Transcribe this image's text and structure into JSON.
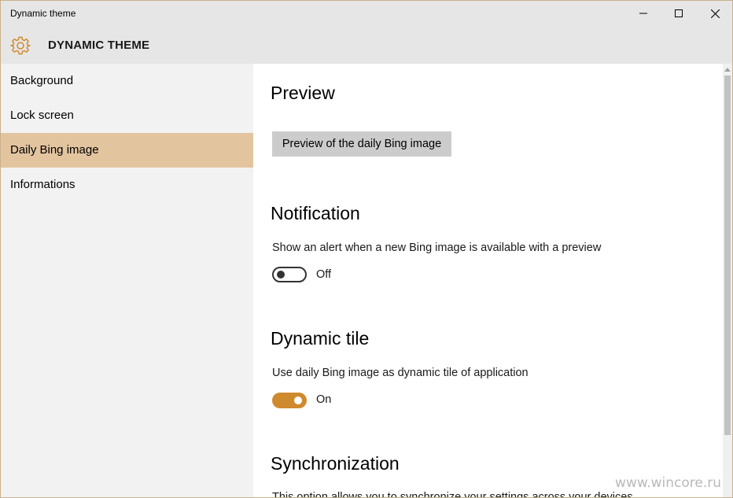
{
  "window": {
    "title": "Dynamic theme"
  },
  "caption_buttons": {
    "minimize": "minimize-icon",
    "maximize": "maximize-icon",
    "close": "close-icon"
  },
  "header": {
    "icon": "gear-icon",
    "title": "DYNAMIC THEME"
  },
  "sidebar": {
    "items": [
      {
        "label": "Background",
        "selected": false
      },
      {
        "label": "Lock screen",
        "selected": false
      },
      {
        "label": "Daily Bing image",
        "selected": true
      },
      {
        "label": "Informations",
        "selected": false
      }
    ]
  },
  "main": {
    "preview": {
      "title": "Preview",
      "button_label": "Preview of the daily Bing image"
    },
    "notification": {
      "title": "Notification",
      "description": "Show an alert when a new Bing image is available with a preview",
      "toggle_state": "off",
      "toggle_label": "Off"
    },
    "dynamic_tile": {
      "title": "Dynamic tile",
      "description": "Use daily Bing image as dynamic tile of application",
      "toggle_state": "on",
      "toggle_label": "On"
    },
    "synchronization": {
      "title": "Synchronization",
      "description": "This option allows you to synchronize your settings across your devices"
    }
  },
  "colors": {
    "accent": "#d08a2e",
    "selected_nav": "#e2c49f",
    "chrome": "#e6e6e6",
    "sidebar": "#f2f2f2"
  },
  "watermark": "www.wincore.ru"
}
